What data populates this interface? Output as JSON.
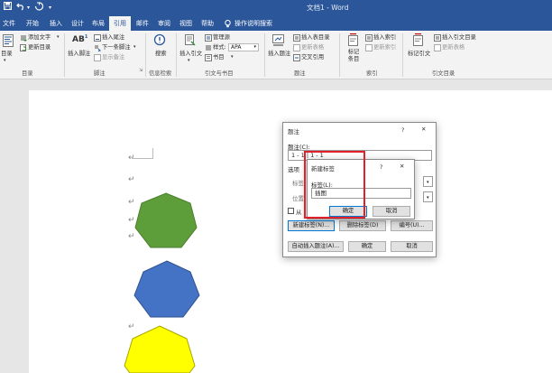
{
  "titlebar": {
    "doc_title": "文档1 - Word",
    "save_icon": "save-icon",
    "undo_icon": "undo-icon",
    "redo_icon": "redo-icon",
    "customize_icon": "customize-qat-icon"
  },
  "tabs": [
    "文件",
    "开始",
    "插入",
    "设计",
    "布局",
    "引用",
    "邮件",
    "审阅",
    "视图",
    "帮助"
  ],
  "active_tab": "引用",
  "tell_me": "操作说明搜索",
  "ribbon": {
    "toc": {
      "toc_btn": "目录",
      "add_text": "添加文字",
      "update_toc": "更新目录",
      "group": "目录"
    },
    "footnotes": {
      "insert_footnote": "插入脚注",
      "insert_endnote": "插入尾注",
      "next_footnote": "下一条脚注",
      "show_notes": "显示备注",
      "group": "脚注"
    },
    "research": {
      "search": "搜索",
      "group": "信息检索"
    },
    "citations": {
      "insert_citation": "插入引文",
      "manage_sources": "管理源",
      "style_label": "样式:",
      "style_value": "APA",
      "bibliography": "书目",
      "group": "引文与书目"
    },
    "captions": {
      "insert_caption": "插入题注",
      "insert_table_of_figures": "插入表目录",
      "update_table": "更新表格",
      "cross_reference": "交叉引用",
      "group": "题注"
    },
    "index": {
      "mark_entry": "标记条目",
      "insert_index": "插入索引",
      "update_index": "更新索引",
      "group": "索引"
    },
    "toa": {
      "mark_citation": "标记引文",
      "insert_toa": "插入引文目录",
      "update_toa": "更新表格",
      "group": "引文目录"
    }
  },
  "caption_dialog": {
    "title": "题注",
    "help": "?",
    "close": "✕",
    "caption_label": "题注(C):",
    "caption_value": "1 - 1 | 1 - 1",
    "options_label": "选项",
    "label_row": "标签(L):",
    "position_row": "位置(P):",
    "exclude_label": "从",
    "new_label_btn": "新建标签(N)...",
    "delete_label_btn": "删除标签(D)",
    "numbering_btn": "编号(U)...",
    "autocaption_btn": "自动插入题注(A)...",
    "ok": "确定",
    "cancel": "取消"
  },
  "new_label_dialog": {
    "title": "新建标签",
    "help": "?",
    "close": "✕",
    "label_caption": "标签(L):",
    "label_value": "插图",
    "ok": "确定",
    "cancel": "取消"
  },
  "paragraph_mark": "↵",
  "colors": {
    "word_blue": "#2b579a",
    "heptagon_green": "#5d9e3a",
    "heptagon_blue": "#4472c4",
    "heptagon_yellow": "#ffff00",
    "highlight_red": "#e0202a"
  }
}
